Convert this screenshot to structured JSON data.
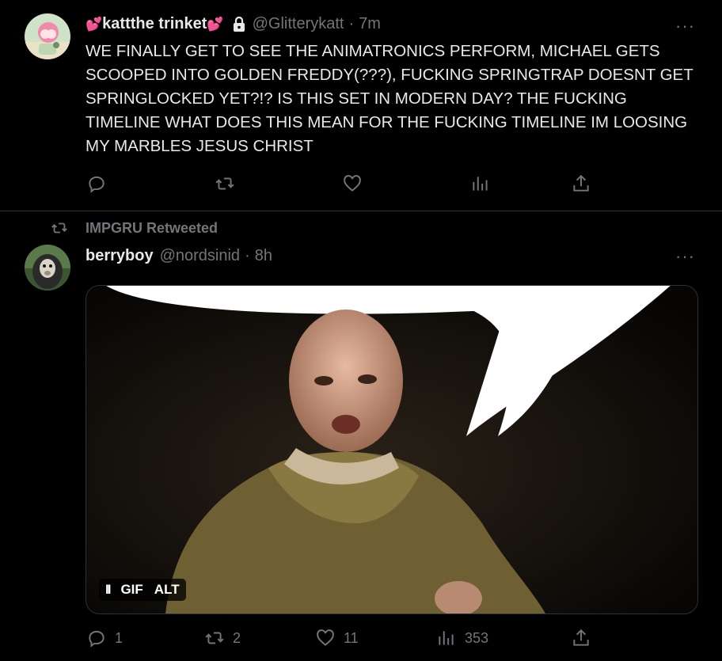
{
  "tweet1": {
    "display_name": "kattthe trinket",
    "name_decoration": "💕",
    "handle": "@Glitterykatt",
    "separator": "·",
    "time": "7m",
    "more": "···",
    "text": "WE FINALLY GET TO SEE THE ANIMATRONICS PERFORM, MICHAEL GETS SCOOPED INTO GOLDEN FREDDY(???), FUCKING SPRINGTRAP DOESNT GET SPRINGLOCKED YET?!? IS THIS SET IN MODERN DAY? THE FUCKING TIMELINE WHAT DOES THIS MEAN FOR THE FUCKING TIMELINE IM LOOSING MY MARBLES JESUS CHRIST",
    "icons": [
      "reply-icon",
      "retweet-icon",
      "like-icon",
      "views-icon",
      "share-icon",
      "lock-icon"
    ]
  },
  "tweet2": {
    "retweeted_by": "IMPGRU Retweeted",
    "display_name": "berryboy",
    "handle": "@nordsinid",
    "separator": "·",
    "time": "8h",
    "more": "···",
    "media_badges": {
      "pause": "II",
      "gif": "GIF",
      "alt": "ALT"
    },
    "stats": {
      "replies": "1",
      "retweets": "2",
      "likes": "11",
      "views": "353"
    }
  },
  "colors": {
    "background": "#000000",
    "text": "#e7e9ea",
    "muted": "#71767b",
    "border": "#2f3336",
    "heart": "#e0245e"
  }
}
